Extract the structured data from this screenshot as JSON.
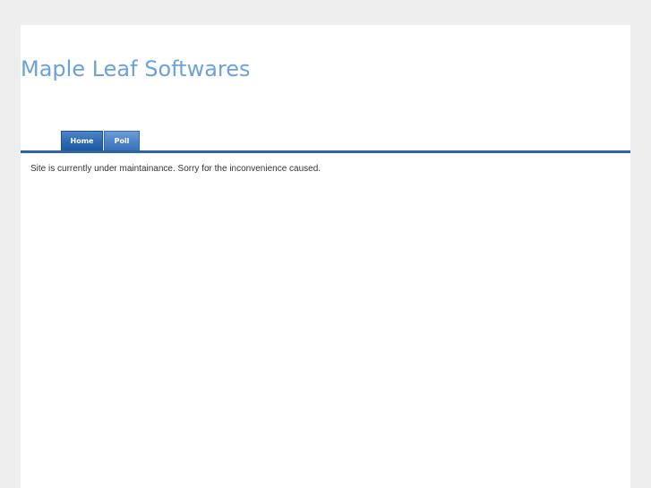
{
  "header": {
    "site_title": "Maple Leaf Softwares"
  },
  "nav": {
    "items": [
      {
        "label": "Home"
      },
      {
        "label": "Poll"
      }
    ]
  },
  "main": {
    "message": "Site is currently under maintainance. Sorry for the inconvenience caused."
  },
  "colors": {
    "page_background": "#eeeeee",
    "content_background": "#ffffff",
    "title": "#6aa2dc",
    "nav_tab": "#2d69b3",
    "nav_bar": "#2a63a8",
    "body_text": "#333333"
  }
}
